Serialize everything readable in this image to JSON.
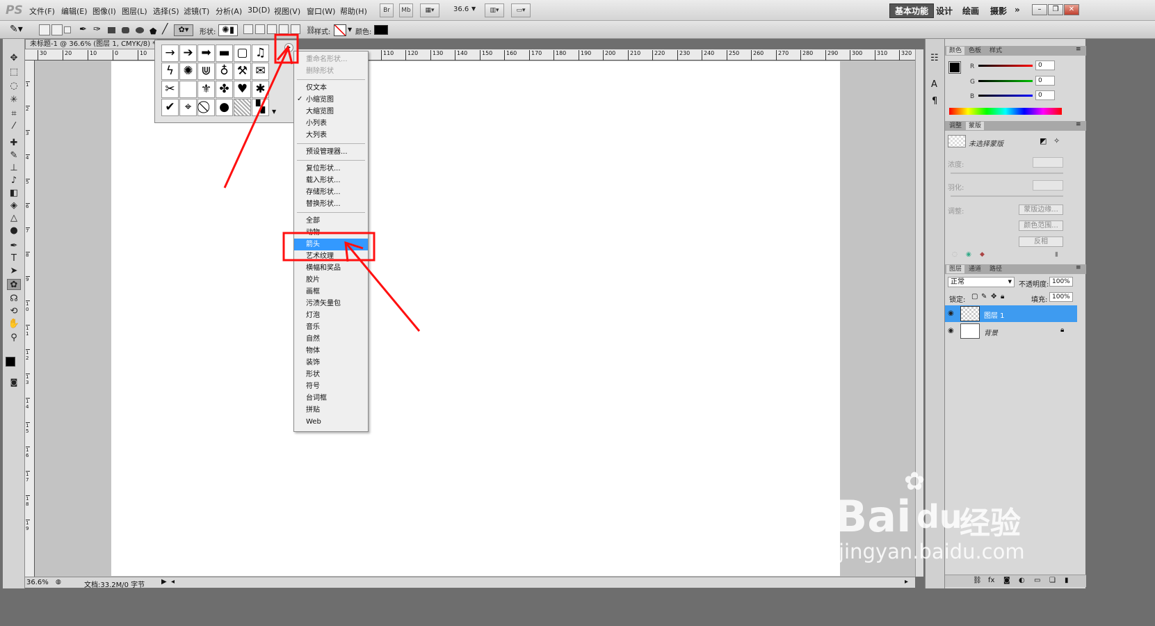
{
  "menubar": {
    "app_logo": "PS",
    "items": [
      "文件(F)",
      "编辑(E)",
      "图像(I)",
      "图层(L)",
      "选择(S)",
      "滤镜(T)",
      "分析(A)",
      "3D(D)",
      "视图(V)",
      "窗口(W)",
      "帮助(H)"
    ],
    "br": "Br",
    "mb": "Mb",
    "zoom": "36.6",
    "workspaces": [
      "基本功能",
      "设计",
      "绘画",
      "摄影"
    ],
    "more": "»"
  },
  "options": {
    "shape_label": "形状:",
    "style_label": "样式:",
    "color_label": "颜色:"
  },
  "document": {
    "tab_title": "未标题-1 @ 36.6% (图层 1, CMYK/8) *",
    "ruler_top": [
      "30",
      "20",
      "10",
      "0",
      "10",
      "110",
      "120",
      "130",
      "140",
      "150",
      "160",
      "170",
      "180",
      "190",
      "200",
      "210",
      "220",
      "230",
      "240",
      "250",
      "260",
      "270",
      "280",
      "290",
      "300",
      "310",
      "320"
    ],
    "ruler_left": [
      "1",
      "2",
      "3",
      "4",
      "5",
      "6",
      "7",
      "8",
      "9",
      "1 0",
      "1 1",
      "1 2",
      "1 3",
      "1 4",
      "1 5",
      "1 6",
      "1 7",
      "1 8",
      "1 9"
    ],
    "status_zoom": "36.6%",
    "status_doc": "文档:33.2M/0 字节"
  },
  "popup_menu": {
    "items": [
      {
        "label": "重命名形状...",
        "disabled": true
      },
      {
        "label": "删除形状",
        "disabled": true
      },
      {
        "sep": true
      },
      {
        "label": "仅文本"
      },
      {
        "label": "小缩览图",
        "checked": true
      },
      {
        "label": "大缩览图"
      },
      {
        "label": "小列表"
      },
      {
        "label": "大列表"
      },
      {
        "sep": true
      },
      {
        "label": "预设管理器..."
      },
      {
        "sep": true
      },
      {
        "label": "复位形状..."
      },
      {
        "label": "载入形状..."
      },
      {
        "label": "存储形状..."
      },
      {
        "label": "替换形状..."
      },
      {
        "sep": true
      },
      {
        "label": "全部"
      },
      {
        "label": "动物"
      },
      {
        "label": "箭头",
        "highlighted": true
      },
      {
        "label": "艺术纹理"
      },
      {
        "label": "横幅和奖品"
      },
      {
        "label": "胶片"
      },
      {
        "label": "画框"
      },
      {
        "label": "污渍矢量包"
      },
      {
        "label": "灯泡"
      },
      {
        "label": "音乐"
      },
      {
        "label": "自然"
      },
      {
        "label": "物体"
      },
      {
        "label": "装饰"
      },
      {
        "label": "形状"
      },
      {
        "label": "符号"
      },
      {
        "label": "台词框"
      },
      {
        "label": "拼贴"
      },
      {
        "label": "Web"
      }
    ]
  },
  "color_panel": {
    "tabs": [
      "颜色",
      "色板",
      "样式"
    ],
    "r_label": "R",
    "g_label": "G",
    "b_label": "B",
    "r": "0",
    "g": "0",
    "b": "0"
  },
  "mask_panel": {
    "tabs": [
      "调整",
      "蒙版"
    ],
    "no_mask": "未选择蒙版",
    "density": "浓度:",
    "feather": "羽化:",
    "refine": "调整:",
    "mask_edge": "蒙版边缘...",
    "color_range": "颜色范围...",
    "invert": "反相"
  },
  "layers_panel": {
    "tabs": [
      "图层",
      "通道",
      "路径"
    ],
    "blend_mode": "正常",
    "opacity_label": "不透明度:",
    "opacity": "100%",
    "lock_label": "锁定:",
    "fill_label": "填充:",
    "fill": "100%",
    "layers": [
      {
        "name": "图层 1",
        "selected": true
      },
      {
        "name": "背景",
        "selected": false
      }
    ]
  },
  "watermark": {
    "brand": "Bai",
    "brand2": "du",
    "cn": "经验",
    "url": "jingyan.baidu.com"
  },
  "colors": {
    "highlight": "#3399ff",
    "annotation": "#ff1010",
    "selected_layer": "#3e9bf0"
  }
}
